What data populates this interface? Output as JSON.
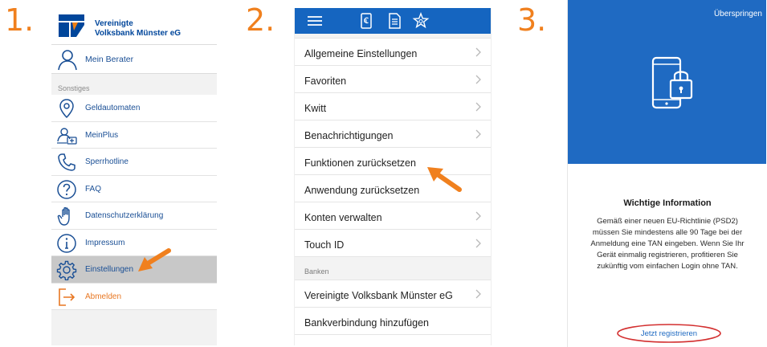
{
  "steps": {
    "one": "1.",
    "two": "2.",
    "three": "3."
  },
  "panel1": {
    "bank_name_line1": "Vereinigte",
    "bank_name_line2": "Volksbank Münster eG",
    "advisor_label": "Mein Berater",
    "section_label": "Sonstiges",
    "menu": [
      {
        "label": "Geldautomaten",
        "icon": "map-pin-icon"
      },
      {
        "label": "MeinPlus",
        "icon": "meinplus-icon"
      },
      {
        "label": "Sperrhotline",
        "icon": "phone-icon"
      },
      {
        "label": "FAQ",
        "icon": "question-icon"
      },
      {
        "label": "Datenschutzerklärung",
        "icon": "hand-stop-icon"
      },
      {
        "label": "Impressum",
        "icon": "info-icon"
      },
      {
        "label": "Einstellungen",
        "icon": "gear-icon"
      },
      {
        "label": "Abmelden",
        "icon": "logout-icon"
      }
    ]
  },
  "panel2": {
    "settings": [
      {
        "label": "Allgemeine Einstellungen",
        "chevron": true
      },
      {
        "label": "Favoriten",
        "chevron": true
      },
      {
        "label": "Kwitt",
        "chevron": true
      },
      {
        "label": "Benachrichtigungen",
        "chevron": true
      },
      {
        "label": "Funktionen zurücksetzen",
        "chevron": false
      },
      {
        "label": "Anwendung zurücksetzen",
        "chevron": false
      },
      {
        "label": "Konten verwalten",
        "chevron": true
      },
      {
        "label": "Touch ID",
        "chevron": true
      }
    ],
    "banks_header": "Banken",
    "banks": [
      {
        "label": "Vereinigte  Volksbank Münster eG",
        "chevron": true
      },
      {
        "label": "Bankverbindung hinzufügen",
        "chevron": false
      }
    ]
  },
  "panel3": {
    "skip_label": "Überspringen",
    "info_title": "Wichtige Information",
    "info_lines": [
      "Gemäß einer neuen EU-Richtlinie (PSD2)",
      "müssen Sie mindestens alle 90 Tage bei der",
      "Anmeldung eine TAN eingeben. Wenn Sie Ihr",
      "Gerät einmalig registrieren, profitieren Sie",
      "zukünftig vom einfachen Login ohne TAN."
    ],
    "register_label": "Jetzt registrieren"
  },
  "colors": {
    "accent_orange": "#f0801e",
    "brand_blue": "#1565c0",
    "hero_blue": "#1f6ac2",
    "menu_text_blue": "#1a4f95",
    "highlight_red": "#d32f2f"
  }
}
